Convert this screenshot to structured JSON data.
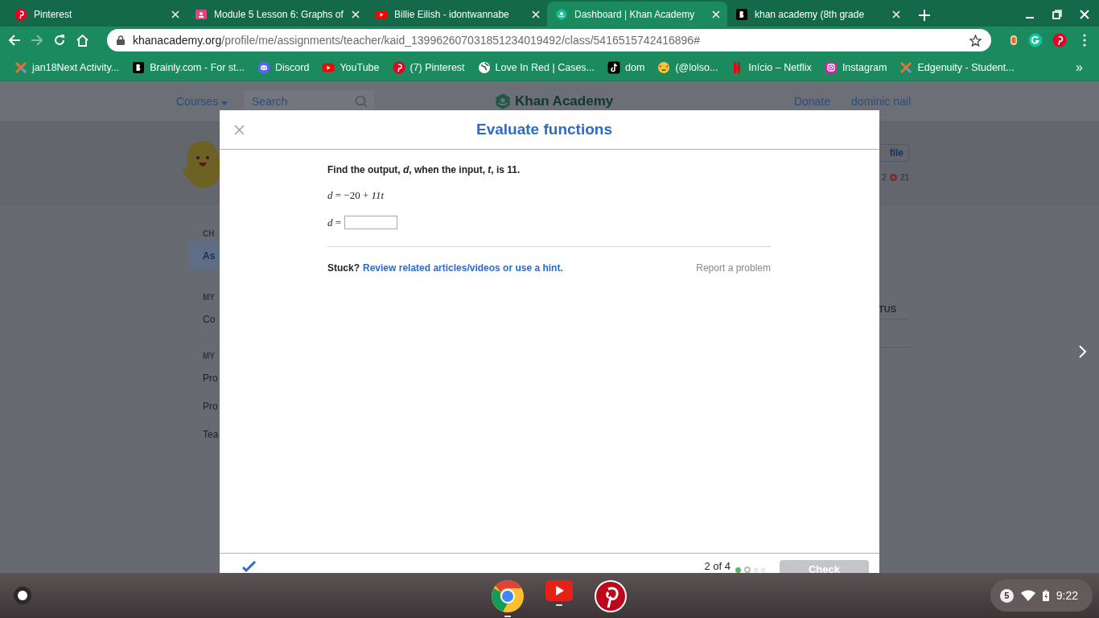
{
  "browser": {
    "tabs": [
      {
        "title": "Pinterest",
        "kind": "pinterest",
        "selected": false
      },
      {
        "title": "Module 5 Lesson 6: Graphs of",
        "kind": "classroom",
        "selected": false
      },
      {
        "title": "Billie Eilish - idontwannabe",
        "kind": "youtube",
        "selected": false
      },
      {
        "title": "Dashboard | Khan Academy",
        "kind": "khan",
        "selected": true
      },
      {
        "title": "khan academy (8th grade",
        "kind": "brainly",
        "selected": false
      }
    ],
    "url": "khanacademy.org/profile/me/assignments/teacher/kaid_139962607031851234019492/class/5416515742416896#",
    "bookmarks": [
      {
        "title": "jan18Next Activity...",
        "kind": "edgenuity"
      },
      {
        "title": "Brainly.com - For st...",
        "kind": "brainly"
      },
      {
        "title": "Discord",
        "kind": "discord"
      },
      {
        "title": "YouTube",
        "kind": "youtube"
      },
      {
        "title": "(7) Pinterest",
        "kind": "pinterest"
      },
      {
        "title": "Love In Red | Cases...",
        "kind": "globe"
      },
      {
        "title": "dom",
        "kind": "tiktok"
      },
      {
        "title": "(@lolso...",
        "kind": "emoji"
      },
      {
        "title": "Início – Netflix",
        "kind": "netflix"
      },
      {
        "title": "Instagram",
        "kind": "instagram"
      },
      {
        "title": "Edgenuity - Student...",
        "kind": "edgenuity"
      }
    ],
    "bookmarks_overflow": "»"
  },
  "background_page": {
    "header": {
      "courses": "Courses",
      "search_placeholder": "Search",
      "logo": "Khan Academy",
      "donate": "Donate",
      "user": "dominic nail"
    },
    "profile_button": "file",
    "stats": [
      {
        "value": "2"
      },
      {
        "value": "21"
      }
    ],
    "sidebar": [
      {
        "kind": "heading",
        "text": "CH",
        "selected": false
      },
      {
        "kind": "item",
        "text": "As",
        "selected": true
      },
      {
        "kind": "heading",
        "text": "MY",
        "selected": false
      },
      {
        "kind": "item",
        "text": "Co",
        "selected": false
      },
      {
        "kind": "heading",
        "text": "MY",
        "selected": false
      },
      {
        "kind": "item",
        "text": "Pro",
        "selected": false
      },
      {
        "kind": "item",
        "text": "Pro",
        "selected": false
      },
      {
        "kind": "item",
        "text": "Tea",
        "selected": false
      }
    ],
    "table_heading": "TUS"
  },
  "modal": {
    "title": "Evaluate functions",
    "question": "Find the output, *d*, when the input, *t*, is 11.",
    "equation": "*d* = −20 + *11t*",
    "answer_label": "*d* =",
    "stuck": "Stuck?",
    "hint_link": "Review related articles/videos or use a hint.",
    "report": "Report a problem",
    "progress_text": "2 of 4",
    "progress": [
      {
        "kind": "correct"
      },
      {
        "kind": "current"
      },
      {
        "kind": "pending"
      },
      {
        "kind": "pending"
      }
    ],
    "check_button": {
      "label": "Check",
      "disabled": true
    }
  },
  "shelf": {
    "apps": [
      {
        "kind": "chrome",
        "active": true
      },
      {
        "kind": "youtube",
        "active": true
      },
      {
        "kind": "pinterest",
        "active": false
      }
    ],
    "notifications": "5",
    "time": "9:22"
  }
}
